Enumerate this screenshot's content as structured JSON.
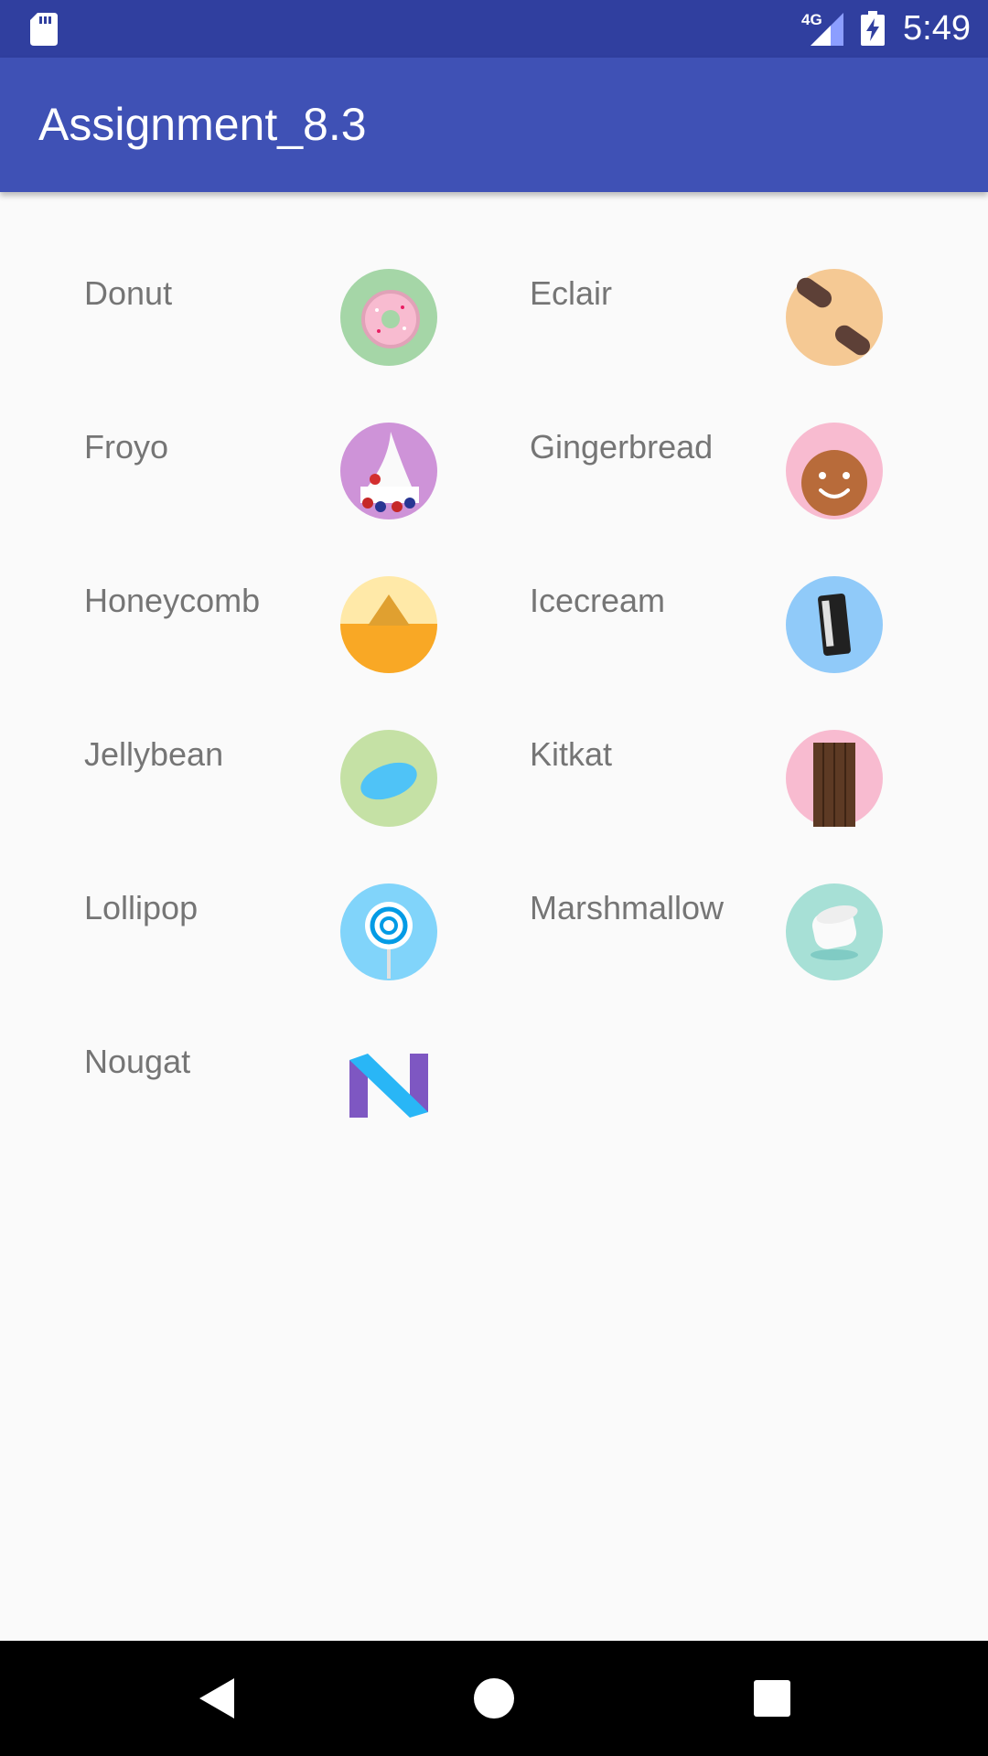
{
  "status_bar": {
    "network_label": "4G",
    "time": "5:49",
    "icons": [
      "sd-card-icon",
      "signal-icon",
      "battery-charging-icon"
    ]
  },
  "app_bar": {
    "title": "Assignment_8.3"
  },
  "versions": [
    {
      "label": "Donut",
      "icon": "donut-icon"
    },
    {
      "label": "Eclair",
      "icon": "eclair-icon"
    },
    {
      "label": "Froyo",
      "icon": "froyo-icon"
    },
    {
      "label": "Gingerbread",
      "icon": "gingerbread-icon"
    },
    {
      "label": "Honeycomb",
      "icon": "honeycomb-icon"
    },
    {
      "label": "Icecream",
      "icon": "icecream-icon"
    },
    {
      "label": "Jellybean",
      "icon": "jellybean-icon"
    },
    {
      "label": "Kitkat",
      "icon": "kitkat-icon"
    },
    {
      "label": "Lollipop",
      "icon": "lollipop-icon"
    },
    {
      "label": "Marshmallow",
      "icon": "marshmallow-icon"
    },
    {
      "label": "Nougat",
      "icon": "nougat-icon"
    }
  ],
  "nav_bar": {
    "buttons": [
      "back-icon",
      "home-icon",
      "recents-icon"
    ]
  },
  "colors": {
    "status_bar": "#303f9f",
    "app_bar": "#3f51b5",
    "background": "#fafafa",
    "label": "#757575"
  }
}
